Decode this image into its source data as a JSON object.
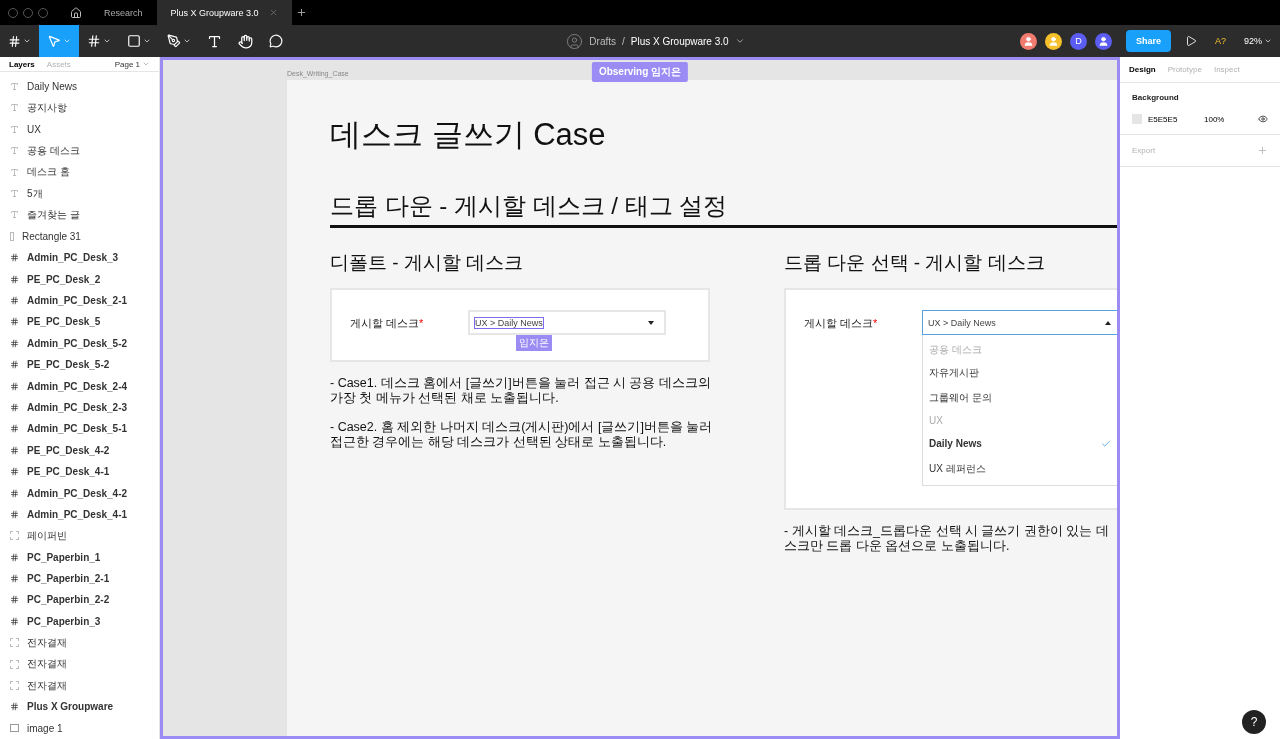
{
  "tabs": [
    {
      "label": "Research",
      "selected": false
    },
    {
      "label": "Plus X Groupware 3.0",
      "selected": true
    }
  ],
  "tools": [
    {
      "kind": "menu",
      "selected": false
    },
    {
      "kind": "move",
      "selected": true
    },
    {
      "kind": "frame",
      "selected": false
    },
    {
      "kind": "shape",
      "selected": false
    },
    {
      "kind": "pen",
      "selected": false
    },
    {
      "kind": "text",
      "selected": false
    },
    {
      "kind": "hand",
      "selected": false
    },
    {
      "kind": "comment",
      "selected": false
    }
  ],
  "breadcrumb": {
    "folder": "Drafts",
    "separator": "/",
    "file": "Plus X Groupware 3.0"
  },
  "avatars": [
    {
      "color": "#f07b6e"
    },
    {
      "color": "#f5c02c"
    },
    {
      "color": "#5b5cf0",
      "initial": "D"
    },
    {
      "color": "#5b5cf0"
    }
  ],
  "share": "Share",
  "font_warning": "A?",
  "zoom": "92%",
  "left_panel": {
    "tabs": [
      {
        "label": "Layers",
        "selected": true
      },
      {
        "label": "Assets",
        "selected": false
      }
    ],
    "page": "Page 1",
    "layers": [
      {
        "kind": "text",
        "name": "Daily News"
      },
      {
        "kind": "text",
        "name": "공지사항"
      },
      {
        "kind": "text",
        "name": "UX"
      },
      {
        "kind": "text",
        "name": "공용 데스크"
      },
      {
        "kind": "text",
        "name": "데스크 홈"
      },
      {
        "kind": "text",
        "name": "5개"
      },
      {
        "kind": "text",
        "name": "즐겨찾는 글"
      },
      {
        "kind": "rect",
        "name": "Rectangle 31"
      },
      {
        "kind": "frame",
        "name": "Admin_PC_Desk_3"
      },
      {
        "kind": "frame",
        "name": "PE_PC_Desk_2"
      },
      {
        "kind": "frame",
        "name": "Admin_PC_Desk_2-1"
      },
      {
        "kind": "frame",
        "name": "PE_PC_Desk_5"
      },
      {
        "kind": "frame",
        "name": "Admin_PC_Desk_5-2"
      },
      {
        "kind": "frame",
        "name": "PE_PC_Desk_5-2"
      },
      {
        "kind": "frame",
        "name": "Admin_PC_Desk_2-4"
      },
      {
        "kind": "frame",
        "name": "Admin_PC_Desk_2-3"
      },
      {
        "kind": "frame",
        "name": "Admin_PC_Desk_5-1"
      },
      {
        "kind": "frame",
        "name": "PE_PC_Desk_4-2"
      },
      {
        "kind": "frame",
        "name": "PE_PC_Desk_4-1"
      },
      {
        "kind": "frame",
        "name": "Admin_PC_Desk_4-2"
      },
      {
        "kind": "frame",
        "name": "Admin_PC_Desk_4-1"
      },
      {
        "kind": "group",
        "name": "페이퍼빈"
      },
      {
        "kind": "frame",
        "name": "PC_Paperbin_1"
      },
      {
        "kind": "frame",
        "name": "PC_Paperbin_2-1"
      },
      {
        "kind": "frame",
        "name": "PC_Paperbin_2-2"
      },
      {
        "kind": "frame",
        "name": "PC_Paperbin_3"
      },
      {
        "kind": "group",
        "name": "전자결재"
      },
      {
        "kind": "group",
        "name": "전자결재"
      },
      {
        "kind": "group",
        "name": "전자결재"
      },
      {
        "kind": "frame",
        "name": "Plus X Groupware"
      },
      {
        "kind": "image",
        "name": "image 1"
      }
    ]
  },
  "canvas": {
    "observing": "Observing 임지은",
    "frame_label": "Desk_Writing_Case",
    "title": "데스크 글쓰기 Case",
    "subtitle": "드롭 다운 - 게시할 데스크 / 태그 설정",
    "left": {
      "heading": "디폴트 - 게시할 데스크",
      "field_label": "게시할 데스크",
      "required": "*",
      "value": "UX > Daily News",
      "cursor_label": "임지은",
      "notes": [
        "- Case1. 데스크 홈에서 [글쓰기]버튼을 눌러 접근 시 공용 데스크의 가장 첫 메뉴가 선택된 채로 노출됩니다.",
        "- Case2. 홈 제외한 나머지 데스크(게시판)에서 [글쓰기]버튼을 눌러 접근한 경우에는 해당 데스크가 선택된 상태로 노출됩니다."
      ]
    },
    "right": {
      "heading": "드롭 다운 선택 - 게시할 데스크",
      "field_label": "게시할 데스크",
      "required": "*",
      "value": "UX > Daily News",
      "expanded": true,
      "options": [
        {
          "kind": "group",
          "label": "공용 데스크"
        },
        {
          "kind": "option",
          "label": "자유게시판",
          "selected": false
        },
        {
          "kind": "option",
          "label": "그룹웨어 문의",
          "selected": false
        },
        {
          "kind": "group",
          "label": "UX"
        },
        {
          "kind": "option",
          "label": "Daily News",
          "selected": true
        },
        {
          "kind": "option",
          "label": "UX 레퍼런스",
          "selected": false
        }
      ],
      "note": "- 게시할 데스크_드롭다운 선택 시 글쓰기 권한이 있는 데스크만 드롭 다운 옵션으로 노출됩니다."
    }
  },
  "right_panel": {
    "tabs": [
      {
        "label": "Design",
        "selected": true
      },
      {
        "label": "Prototype",
        "selected": false
      },
      {
        "label": "Inspect",
        "selected": false
      }
    ],
    "background_heading": "Background",
    "background_hex": "E5E5E5",
    "background_opacity": "100%",
    "export": "Export"
  },
  "help": "?"
}
